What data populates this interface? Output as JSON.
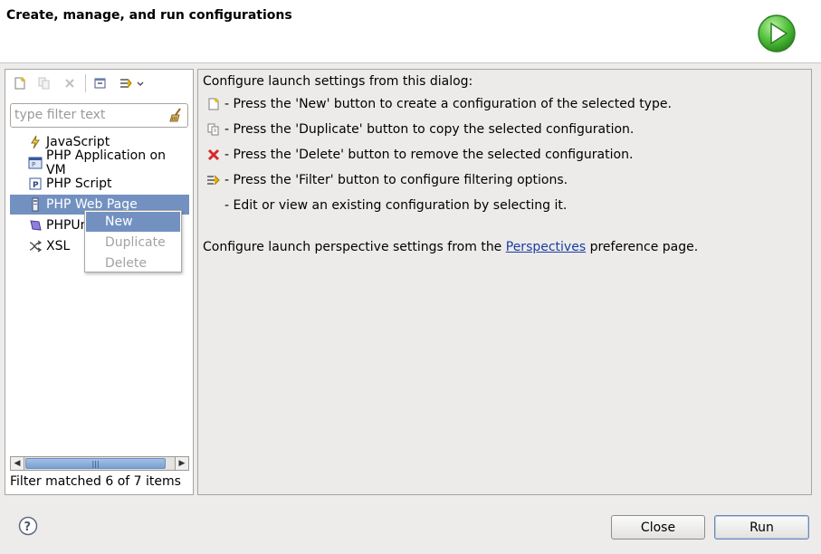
{
  "header": {
    "title": "Create, manage, and run configurations"
  },
  "toolbar": {
    "items": [
      {
        "name": "new-config-icon",
        "enabled": true
      },
      {
        "name": "duplicate-config-icon",
        "enabled": false
      },
      {
        "name": "delete-config-icon",
        "enabled": false
      },
      {
        "name": "collapse-all-icon",
        "enabled": true
      },
      {
        "name": "filter-icon",
        "enabled": true
      }
    ]
  },
  "filter": {
    "placeholder": "type filter text",
    "value": ""
  },
  "tree": {
    "items": [
      {
        "label": "JavaScript",
        "icon": "javascript-icon"
      },
      {
        "label": "PHP Application on VM",
        "icon": "php-application-icon"
      },
      {
        "label": "PHP Script",
        "icon": "php-script-icon"
      },
      {
        "label": "PHP Web Page",
        "icon": "php-web-page-icon",
        "selected": true
      },
      {
        "label": "PHPUnit",
        "icon": "phpunit-icon"
      },
      {
        "label": "XSL",
        "icon": "xsl-icon"
      }
    ]
  },
  "context_menu": {
    "items": [
      {
        "label": "New",
        "highlighted": true,
        "enabled": true
      },
      {
        "label": "Duplicate",
        "enabled": false
      },
      {
        "label": "Delete",
        "enabled": false
      }
    ]
  },
  "status": {
    "filter_matched": "Filter matched 6 of 7 items"
  },
  "help": {
    "intro": "Configure launch settings from this dialog:",
    "lines": [
      {
        "icon": "new-icon",
        "text": "- Press the 'New' button to create a configuration of the selected type."
      },
      {
        "icon": "duplicate-icon",
        "text": "- Press the 'Duplicate' button to copy the selected configuration."
      },
      {
        "icon": "delete-icon",
        "text": "- Press the 'Delete' button to remove the selected configuration."
      },
      {
        "icon": "filter-icon",
        "text": "- Press the 'Filter' button to configure filtering options."
      },
      {
        "icon": "",
        "text": "- Edit or view an existing configuration by selecting it."
      }
    ],
    "perspective_prefix": "Configure launch perspective settings from the ",
    "perspective_link": "Perspectives",
    "perspective_suffix": " preference page."
  },
  "buttons": {
    "close": "Close",
    "run": "Run"
  },
  "colors": {
    "selection": "#7291c1",
    "link": "#1a3ea0",
    "run_green": "#3da62b"
  }
}
